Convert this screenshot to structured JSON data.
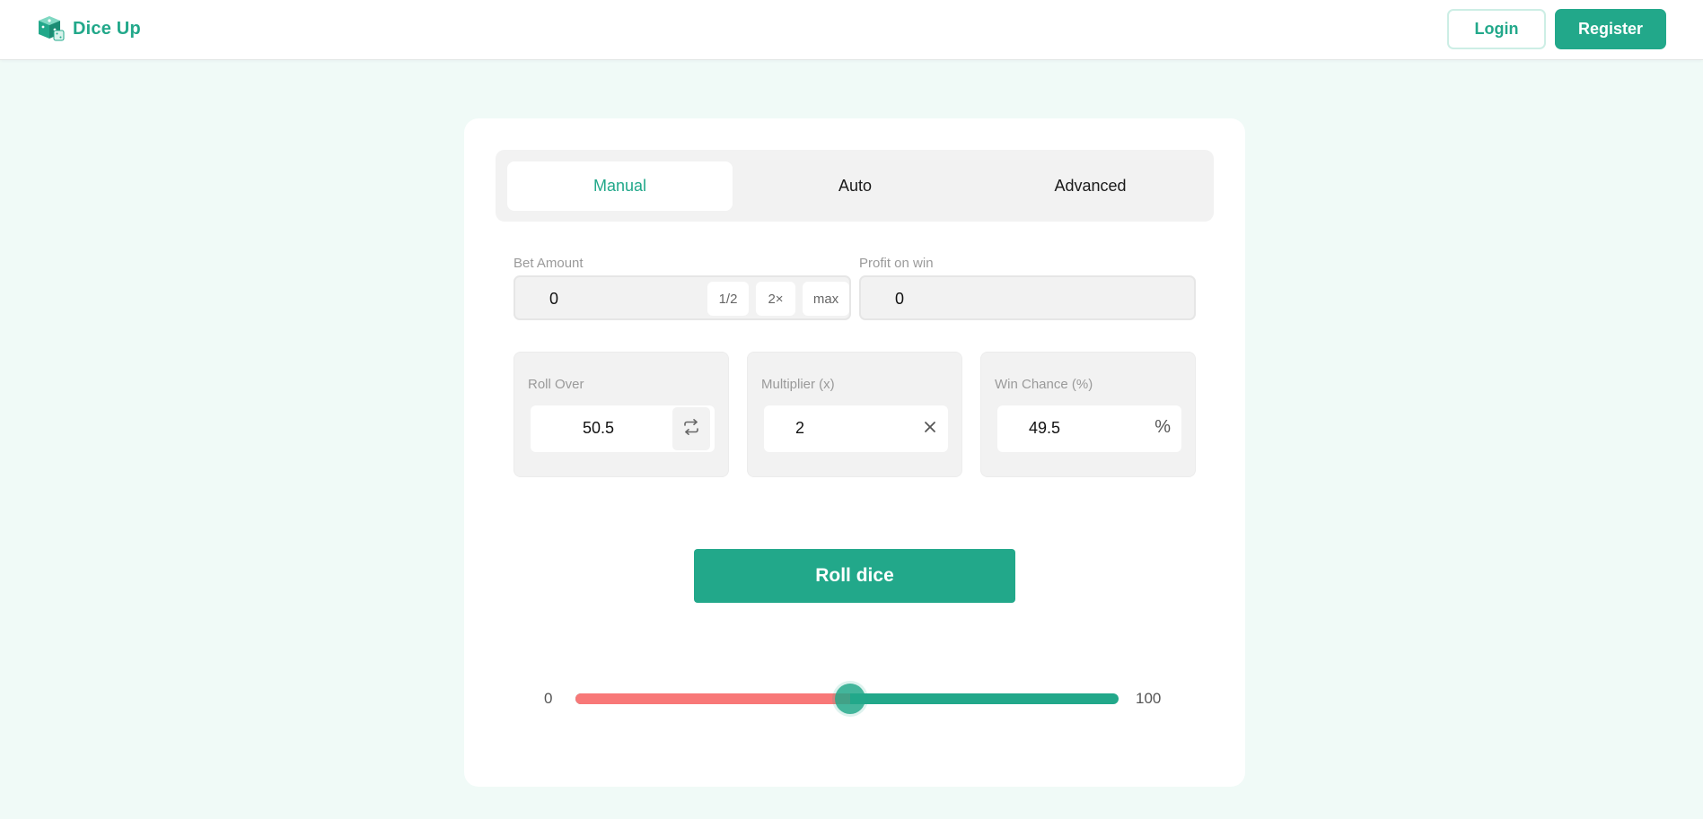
{
  "app": {
    "name": "Dice Up",
    "brand_color": "#22a88a",
    "logo_icon": "dice-logo-icon"
  },
  "header": {
    "login_label": "Login",
    "register_label": "Register"
  },
  "tabs": [
    {
      "label": "Manual",
      "active": true
    },
    {
      "label": "Auto",
      "active": false
    },
    {
      "label": "Advanced",
      "active": false
    }
  ],
  "bet": {
    "label": "Bet Amount",
    "value": "0",
    "half_label": "1/2",
    "double_label": "2×",
    "max_label": "max"
  },
  "profit": {
    "label": "Profit on win",
    "value": "0"
  },
  "roll_over": {
    "label": "Roll Over",
    "value": "50.5",
    "swap_icon": "swap-icon"
  },
  "multiplier": {
    "label": "Multiplier (x)",
    "value": "2",
    "suffix_icon": "times-icon"
  },
  "win_chance": {
    "label": "Win Chance (%)",
    "value": "49.5",
    "suffix": "%"
  },
  "roll_button_label": "Roll dice",
  "slider": {
    "min_label": "0",
    "max_label": "100",
    "min": 0,
    "max": 100,
    "value": 50.5,
    "lose_color": "#f87878",
    "win_color": "#22a88a"
  }
}
